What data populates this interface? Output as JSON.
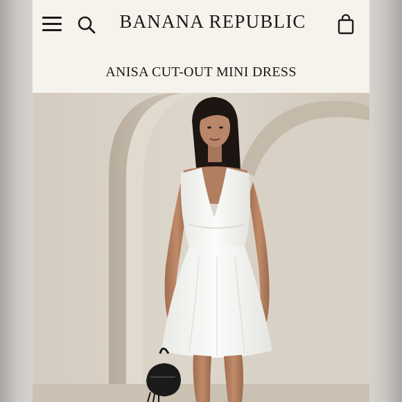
{
  "header": {
    "brand": "BANANA REPUBLIC",
    "menu_icon": "hamburger-menu-icon",
    "search_icon": "search-icon",
    "bag_icon": "shopping-bag-icon"
  },
  "product": {
    "title": "ANISA CUT-OUT MINI DRESS",
    "image": "model-in-white-mini-dress-photo"
  },
  "colors": {
    "header_bg": "#f6f3ec",
    "text": "#1a1a1a",
    "wall": "#d8d1c6",
    "dress": "#f7f7f5"
  }
}
